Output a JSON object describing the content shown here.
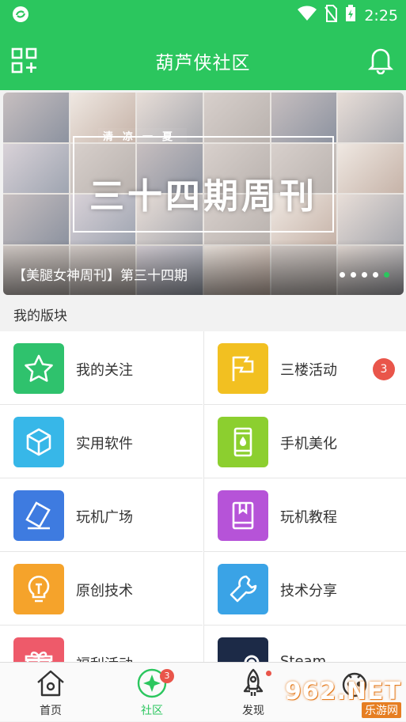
{
  "status": {
    "time": "2:25"
  },
  "header": {
    "title": "葫芦侠社区"
  },
  "banner": {
    "subtitle": "清凉一夏",
    "headline": "三十四期周刊",
    "caption": "【美腿女神周刊】第三十四期",
    "slides": 5,
    "active_slide": 5
  },
  "section": {
    "title": "我的版块"
  },
  "boards": [
    {
      "label": "我的关注",
      "icon": "star-icon",
      "color": "#2fc26d"
    },
    {
      "label": "三楼活动",
      "icon": "flag-icon",
      "color": "#f2c021",
      "badge": "3"
    },
    {
      "label": "实用软件",
      "icon": "cube-icon",
      "color": "#37b7e8"
    },
    {
      "label": "手机美化",
      "icon": "phone-drop-icon",
      "color": "#8ccf2f"
    },
    {
      "label": "玩机广场",
      "icon": "phone-tilt-icon",
      "color": "#3e7be0"
    },
    {
      "label": "玩机教程",
      "icon": "book-icon",
      "color": "#b653d8"
    },
    {
      "label": "原创技术",
      "icon": "bulb-icon",
      "color": "#f5a32b"
    },
    {
      "label": "技术分享",
      "icon": "wrench-icon",
      "color": "#3aa3e6"
    },
    {
      "label": "福利活动",
      "icon": "gift-icon",
      "color": "#ee5a6a"
    },
    {
      "label": "Steam",
      "icon": "steam-icon",
      "color": "#1c2a47"
    }
  ],
  "tabs": [
    {
      "label": "首页",
      "icon": "home-icon"
    },
    {
      "label": "社区",
      "icon": "community-icon",
      "badge": "3",
      "active": true
    },
    {
      "label": "发现",
      "icon": "rocket-icon"
    },
    {
      "label": "",
      "icon": "profile-icon"
    }
  ],
  "watermark": {
    "line1": "962.NET",
    "line2": "乐游网"
  }
}
